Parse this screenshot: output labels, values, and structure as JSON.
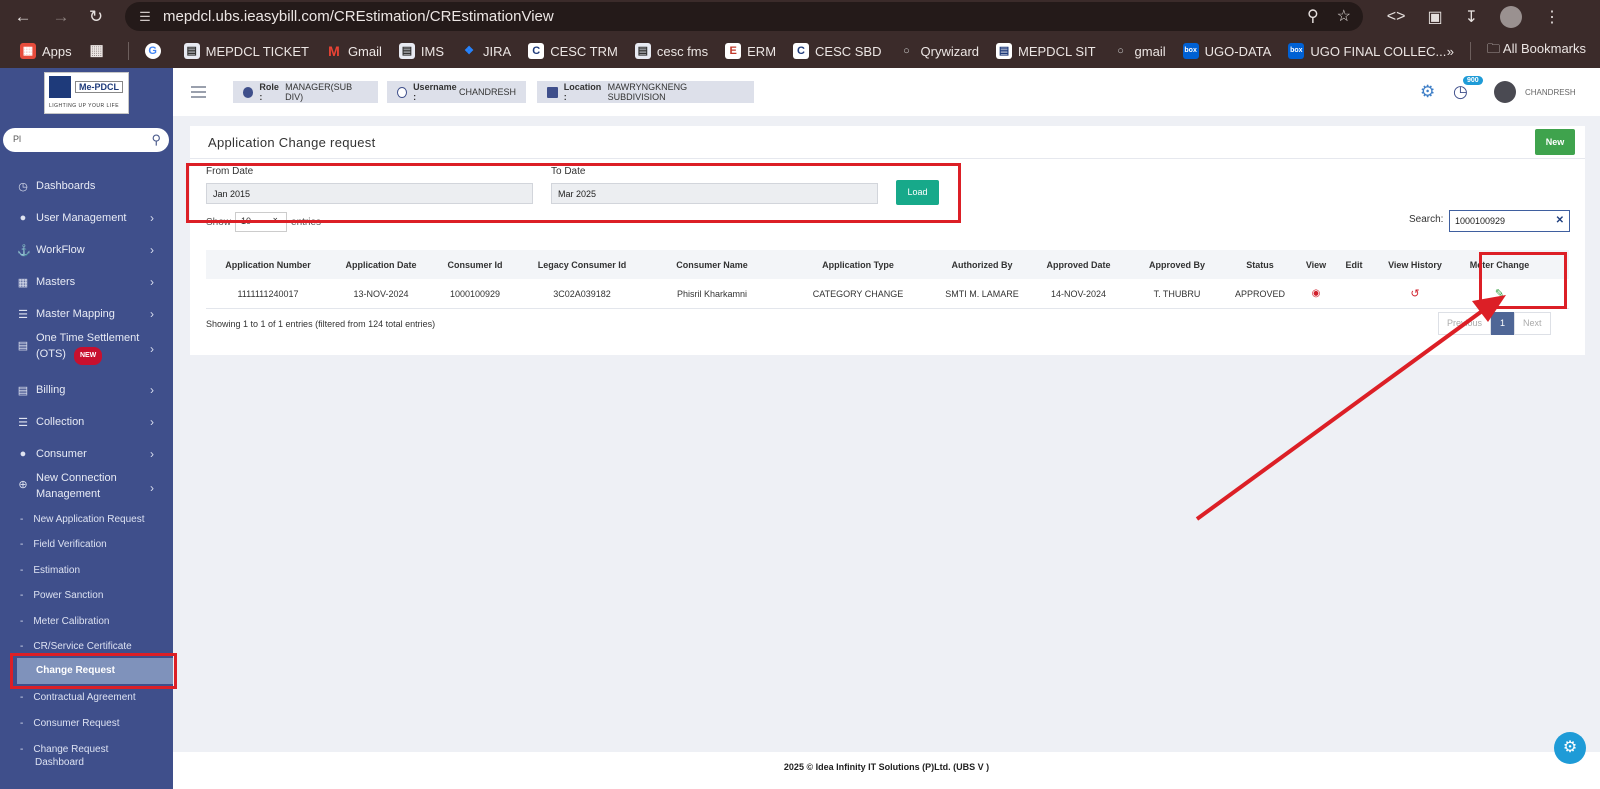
{
  "browser": {
    "url": "mepdcl.ubs.ieasybill.com/CREstimation/CREstimationView",
    "bookmarks": [
      "Apps",
      "MEPDCL TICKET",
      "Gmail",
      "IMS",
      "JIRA",
      "CESC TRM",
      "cesc fms",
      "ERM",
      "CESC SBD",
      "Qrywizard",
      "MEPDCL SIT",
      "gmail",
      "UGO-DATA",
      "UGO FINAL COLLEC..."
    ],
    "all_bookmarks": "All Bookmarks",
    "overflow": "»"
  },
  "sidebar": {
    "logo_text": "Me-PDCL",
    "logo_tagline": "LIGHTING UP YOUR LIFE",
    "search_value": "Pl",
    "items": [
      {
        "label": "Dashboards",
        "icon": "dashboard-icon",
        "chevron": false
      },
      {
        "label": "User Management",
        "icon": "user-icon",
        "chevron": true
      },
      {
        "label": "WorkFlow",
        "icon": "anchor-icon",
        "chevron": true
      },
      {
        "label": "Masters",
        "icon": "grid-icon",
        "chevron": true
      },
      {
        "label": "Master Mapping",
        "icon": "sitemap-icon",
        "chevron": true
      },
      {
        "label": "One Time Settlement",
        "label2": "(OTS)",
        "badge": "NEW",
        "icon": "monitor-icon",
        "chevron": true
      },
      {
        "label": "Billing",
        "icon": "monitor-icon",
        "chevron": true
      },
      {
        "label": "Collection",
        "icon": "list-icon",
        "chevron": true
      },
      {
        "label": "Consumer",
        "icon": "user-icon",
        "chevron": true
      },
      {
        "label": "New Connection",
        "label2": "Management",
        "icon": "plus-circle-icon",
        "chevron": true
      }
    ],
    "subitems": [
      "New Application Request",
      "Field Verification",
      "Estimation",
      "Power Sanction",
      "Meter Calibration",
      "CR/Service Certificate",
      "Change Request",
      "Contractual Agreement",
      "Consumer Request",
      "Change Request",
      "Dashboard"
    ]
  },
  "appbar": {
    "role_label": "Role :",
    "role_value": "MANAGER(SUB DIV)",
    "username_label": "Username :",
    "username_value": "CHANDRESH",
    "location_label": "Location :",
    "location_value": "MAWRYNGKNENG SUBDIVISION",
    "notif_count": "900",
    "user": "CHANDRESH"
  },
  "page": {
    "title": "Application Change request",
    "new_button": "New",
    "from_label": "From Date",
    "from_value": "Jan 2015",
    "to_label": "To Date",
    "to_value": "Mar 2025",
    "load_button": "Load",
    "show_label": "Show",
    "show_value": "10",
    "entries_label": "entries",
    "search_label": "Search:",
    "search_value": "1000100929",
    "columns": [
      "Application Number",
      "Application Date",
      "Consumer Id",
      "Legacy Consumer Id",
      "Consumer Name",
      "Application Type",
      "Authorized By",
      "Approved Date",
      "Approved By",
      "Status",
      "View",
      "Edit",
      "View History",
      "Meter Change"
    ],
    "rows": [
      [
        "1111111240017",
        "13-NOV-2024",
        "1000100929",
        "3C02A039182",
        "Phisril Kharkamni",
        "CATEGORY CHANGE",
        "SMTI M. LAMARE",
        "14-NOV-2024",
        "T. THUBRU",
        "APPROVED"
      ]
    ],
    "showing": "Showing 1 to 1 of 1 entries (filtered from 124 total entries)",
    "pager": {
      "prev": "Previous",
      "page": "1",
      "next": "Next"
    }
  },
  "footer": "2025 © Idea Infinity IT Solutions (P)Ltd. (UBS V )",
  "colors": {
    "sidebar": "#3f4f8b",
    "annotation": "#dc1f26",
    "primary_btn": "#17a98a",
    "new_btn": "#3fa34d"
  }
}
